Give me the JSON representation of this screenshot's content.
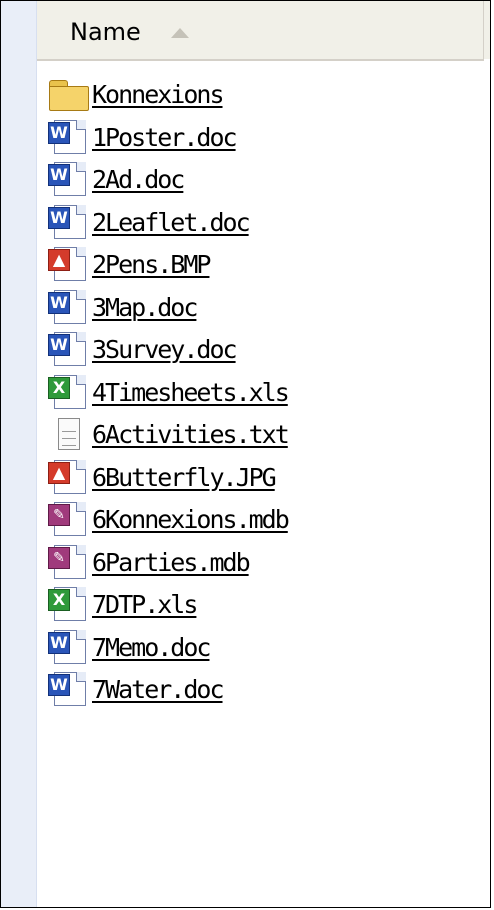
{
  "header": {
    "name_column_label": "Name"
  },
  "files": [
    {
      "name": "Konnexions",
      "icon": "folder-icon"
    },
    {
      "name": "1Poster.doc",
      "icon": "word-doc-icon"
    },
    {
      "name": "2Ad.doc",
      "icon": "word-doc-icon"
    },
    {
      "name": "2Leaflet.doc",
      "icon": "word-doc-icon"
    },
    {
      "name": "2Pens.BMP",
      "icon": "bitmap-image-icon"
    },
    {
      "name": "3Map.doc",
      "icon": "word-doc-icon"
    },
    {
      "name": "3Survey.doc",
      "icon": "word-doc-icon"
    },
    {
      "name": "4Timesheets.xls",
      "icon": "excel-sheet-icon"
    },
    {
      "name": "6Activities.txt",
      "icon": "text-file-icon"
    },
    {
      "name": "6Butterfly.JPG",
      "icon": "jpeg-image-icon"
    },
    {
      "name": "6Konnexions.mdb",
      "icon": "access-db-icon"
    },
    {
      "name": "6Parties.mdb",
      "icon": "access-db-icon"
    },
    {
      "name": "7DTP.xls",
      "icon": "excel-sheet-icon"
    },
    {
      "name": "7Memo.doc",
      "icon": "word-doc-icon"
    },
    {
      "name": "7Water.doc",
      "icon": "word-doc-icon"
    }
  ],
  "colors": {
    "word": "#2a55b8",
    "excel": "#2e9a3a",
    "access": "#a03a7c",
    "image": "#d43b2b",
    "folder": "#f5d36a"
  }
}
